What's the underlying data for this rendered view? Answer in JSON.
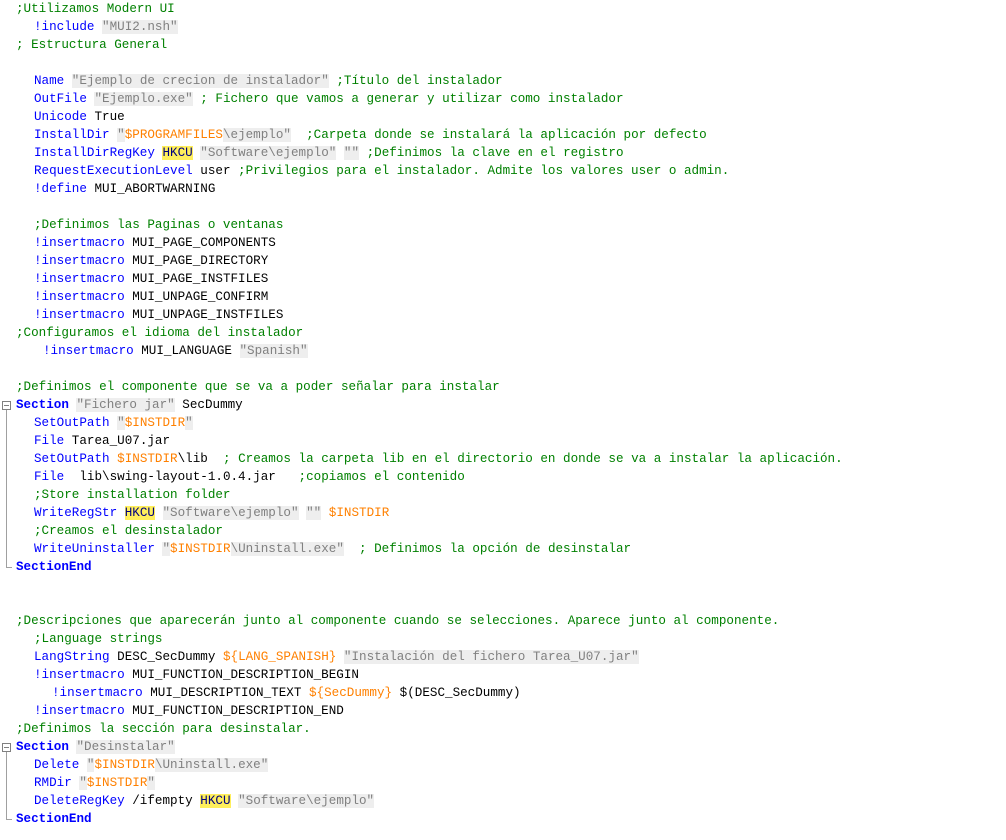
{
  "code": {
    "lines": [
      {
        "indent": 0,
        "tokens": [
          {
            "t": ";Utilizamos Modern UI",
            "c": "comment"
          }
        ]
      },
      {
        "indent": 2,
        "tokens": [
          {
            "t": "!include ",
            "c": "kw"
          },
          {
            "t": "\"MUI2.nsh\"",
            "c": "str"
          }
        ]
      },
      {
        "indent": 0,
        "tokens": [
          {
            "t": "; Estructura General",
            "c": "comment"
          }
        ]
      },
      {
        "indent": 0,
        "tokens": []
      },
      {
        "indent": 2,
        "tokens": [
          {
            "t": "Name ",
            "c": "kw"
          },
          {
            "t": "\"Ejemplo de crecion de instalador\"",
            "c": "str"
          },
          {
            "t": " ;Título del instalador",
            "c": "comment"
          }
        ]
      },
      {
        "indent": 2,
        "tokens": [
          {
            "t": "OutFile ",
            "c": "kw"
          },
          {
            "t": "\"Ejemplo.exe\"",
            "c": "str"
          },
          {
            "t": " ; Fichero que vamos a generar y utilizar como instalador",
            "c": "comment"
          }
        ]
      },
      {
        "indent": 2,
        "tokens": [
          {
            "t": "Unicode ",
            "c": "kw"
          },
          {
            "t": "True",
            "c": "plain"
          }
        ]
      },
      {
        "indent": 2,
        "tokens": [
          {
            "t": "InstallDir ",
            "c": "kw"
          },
          {
            "t": "\"",
            "c": "str"
          },
          {
            "t": "$PROGRAMFILES",
            "c": "var"
          },
          {
            "t": "\\ejemplo\"",
            "c": "str"
          },
          {
            "t": "  ;Carpeta donde se instalará la aplicación por defecto",
            "c": "comment"
          }
        ]
      },
      {
        "indent": 2,
        "tokens": [
          {
            "t": "InstallDirRegKey ",
            "c": "kw"
          },
          {
            "t": "HKCU",
            "c": "hl"
          },
          {
            "t": " ",
            "c": "plain"
          },
          {
            "t": "\"Software\\ejemplo\"",
            "c": "str"
          },
          {
            "t": " ",
            "c": "plain"
          },
          {
            "t": "\"\"",
            "c": "str"
          },
          {
            "t": " ;Definimos la clave en el registro",
            "c": "comment"
          }
        ]
      },
      {
        "indent": 2,
        "tokens": [
          {
            "t": "RequestExecutionLevel ",
            "c": "kw"
          },
          {
            "t": "user",
            "c": "plain"
          },
          {
            "t": " ;Privilegios para el instalador. Admite los valores user o admin.",
            "c": "comment"
          }
        ]
      },
      {
        "indent": 2,
        "tokens": [
          {
            "t": "!define ",
            "c": "kw"
          },
          {
            "t": "MUI_ABORTWARNING",
            "c": "plain"
          }
        ]
      },
      {
        "indent": 0,
        "tokens": []
      },
      {
        "indent": 2,
        "tokens": [
          {
            "t": ";Definimos las Paginas o ventanas",
            "c": "comment"
          }
        ]
      },
      {
        "indent": 2,
        "tokens": [
          {
            "t": "!insertmacro ",
            "c": "kw"
          },
          {
            "t": "MUI_PAGE_COMPONENTS",
            "c": "plain"
          }
        ]
      },
      {
        "indent": 2,
        "tokens": [
          {
            "t": "!insertmacro ",
            "c": "kw"
          },
          {
            "t": "MUI_PAGE_DIRECTORY",
            "c": "plain"
          }
        ]
      },
      {
        "indent": 2,
        "tokens": [
          {
            "t": "!insertmacro ",
            "c": "kw"
          },
          {
            "t": "MUI_PAGE_INSTFILES",
            "c": "plain"
          }
        ]
      },
      {
        "indent": 2,
        "tokens": [
          {
            "t": "!insertmacro ",
            "c": "kw"
          },
          {
            "t": "MUI_UNPAGE_CONFIRM",
            "c": "plain"
          }
        ]
      },
      {
        "indent": 2,
        "tokens": [
          {
            "t": "!insertmacro ",
            "c": "kw"
          },
          {
            "t": "MUI_UNPAGE_INSTFILES",
            "c": "plain"
          }
        ]
      },
      {
        "indent": 0,
        "tokens": [
          {
            "t": ";Configuramos el idioma del instalador",
            "c": "comment"
          }
        ]
      },
      {
        "indent": 3,
        "tokens": [
          {
            "t": "!insertmacro ",
            "c": "kw"
          },
          {
            "t": "MUI_LANGUAGE ",
            "c": "plain"
          },
          {
            "t": "\"Spanish\"",
            "c": "str"
          }
        ]
      },
      {
        "indent": 0,
        "tokens": []
      },
      {
        "indent": 0,
        "tokens": [
          {
            "t": ";Definimos el componente que se va a poder señalar para instalar",
            "c": "comment"
          }
        ]
      },
      {
        "indent": 0,
        "fold": "start",
        "tokens": [
          {
            "t": "Section ",
            "c": "kwb"
          },
          {
            "t": "\"Fichero jar\"",
            "c": "str"
          },
          {
            "t": " SecDummy",
            "c": "plain"
          }
        ]
      },
      {
        "indent": 2,
        "tokens": [
          {
            "t": "SetOutPath ",
            "c": "kw"
          },
          {
            "t": "\"",
            "c": "str"
          },
          {
            "t": "$INSTDIR",
            "c": "var"
          },
          {
            "t": "\"",
            "c": "str"
          }
        ]
      },
      {
        "indent": 2,
        "tokens": [
          {
            "t": "File ",
            "c": "kw"
          },
          {
            "t": "Tarea_U07.jar",
            "c": "plain"
          }
        ]
      },
      {
        "indent": 2,
        "tokens": [
          {
            "t": "SetOutPath ",
            "c": "kw"
          },
          {
            "t": "$INSTDIR",
            "c": "var"
          },
          {
            "t": "\\lib",
            "c": "plain"
          },
          {
            "t": "  ; Creamos la carpeta lib en el directorio en donde se va a instalar la aplicación.",
            "c": "comment"
          }
        ]
      },
      {
        "indent": 2,
        "tokens": [
          {
            "t": "File ",
            "c": "kw"
          },
          {
            "t": " lib\\swing-layout-1.0.4.jar",
            "c": "plain"
          },
          {
            "t": "   ;copiamos el contenido",
            "c": "comment"
          }
        ]
      },
      {
        "indent": 2,
        "tokens": [
          {
            "t": ";Store installation folder",
            "c": "comment"
          }
        ]
      },
      {
        "indent": 2,
        "tokens": [
          {
            "t": "WriteRegStr ",
            "c": "kw"
          },
          {
            "t": "HKCU",
            "c": "hl"
          },
          {
            "t": " ",
            "c": "plain"
          },
          {
            "t": "\"Software\\ejemplo\"",
            "c": "str"
          },
          {
            "t": " ",
            "c": "plain"
          },
          {
            "t": "\"\"",
            "c": "str"
          },
          {
            "t": " ",
            "c": "plain"
          },
          {
            "t": "$INSTDIR",
            "c": "var"
          }
        ]
      },
      {
        "indent": 2,
        "tokens": [
          {
            "t": ";Creamos el desinstalador",
            "c": "comment"
          }
        ]
      },
      {
        "indent": 2,
        "tokens": [
          {
            "t": "WriteUninstaller ",
            "c": "kw"
          },
          {
            "t": "\"",
            "c": "str"
          },
          {
            "t": "$INSTDIR",
            "c": "var"
          },
          {
            "t": "\\Uninstall.exe\"",
            "c": "str"
          },
          {
            "t": "  ; Definimos la opción de desinstalar",
            "c": "comment"
          }
        ]
      },
      {
        "indent": 0,
        "fold": "end",
        "tokens": [
          {
            "t": "SectionEnd",
            "c": "kwb"
          }
        ]
      },
      {
        "indent": 0,
        "tokens": []
      },
      {
        "indent": 0,
        "tokens": []
      },
      {
        "indent": 0,
        "tokens": [
          {
            "t": ";Descripciones que aparecerán junto al componente cuando se selecciones. Aparece junto al componente.",
            "c": "comment"
          }
        ]
      },
      {
        "indent": 2,
        "tokens": [
          {
            "t": ";Language strings",
            "c": "comment"
          }
        ]
      },
      {
        "indent": 2,
        "tokens": [
          {
            "t": "LangString ",
            "c": "kw"
          },
          {
            "t": "DESC_SecDummy ",
            "c": "plain"
          },
          {
            "t": "${LANG_SPANISH}",
            "c": "var"
          },
          {
            "t": " ",
            "c": "plain"
          },
          {
            "t": "\"Instalación del fichero Tarea_U07.jar\"",
            "c": "str"
          }
        ]
      },
      {
        "indent": 2,
        "tokens": [
          {
            "t": "!insertmacro ",
            "c": "kw"
          },
          {
            "t": "MUI_FUNCTION_DESCRIPTION_BEGIN",
            "c": "plain"
          }
        ]
      },
      {
        "indent": 4,
        "tokens": [
          {
            "t": "!insertmacro ",
            "c": "kw"
          },
          {
            "t": "MUI_DESCRIPTION_TEXT ",
            "c": "plain"
          },
          {
            "t": "${SecDummy}",
            "c": "var"
          },
          {
            "t": " $(DESC_SecDummy)",
            "c": "plain"
          }
        ]
      },
      {
        "indent": 2,
        "tokens": [
          {
            "t": "!insertmacro ",
            "c": "kw"
          },
          {
            "t": "MUI_FUNCTION_DESCRIPTION_END",
            "c": "plain"
          }
        ]
      },
      {
        "indent": 0,
        "tokens": [
          {
            "t": ";Definimos la sección para desinstalar.",
            "c": "comment"
          }
        ]
      },
      {
        "indent": 0,
        "fold": "start",
        "tokens": [
          {
            "t": "Section ",
            "c": "kwb"
          },
          {
            "t": "\"Desinstalar\"",
            "c": "str"
          }
        ]
      },
      {
        "indent": 2,
        "tokens": [
          {
            "t": "Delete ",
            "c": "kw"
          },
          {
            "t": "\"",
            "c": "str"
          },
          {
            "t": "$INSTDIR",
            "c": "var"
          },
          {
            "t": "\\Uninstall.exe\"",
            "c": "str"
          }
        ]
      },
      {
        "indent": 2,
        "tokens": [
          {
            "t": "RMDir ",
            "c": "kw"
          },
          {
            "t": "\"",
            "c": "str"
          },
          {
            "t": "$INSTDIR",
            "c": "var"
          },
          {
            "t": "\"",
            "c": "str"
          }
        ]
      },
      {
        "indent": 2,
        "tokens": [
          {
            "t": "DeleteRegKey ",
            "c": "kw"
          },
          {
            "t": "/ifempty ",
            "c": "plain"
          },
          {
            "t": "HKCU",
            "c": "hl"
          },
          {
            "t": " ",
            "c": "plain"
          },
          {
            "t": "\"Software\\ejemplo\"",
            "c": "str"
          }
        ]
      },
      {
        "indent": 0,
        "fold": "end",
        "tokens": [
          {
            "t": "SectionEnd",
            "c": "kwb"
          }
        ]
      }
    ]
  }
}
